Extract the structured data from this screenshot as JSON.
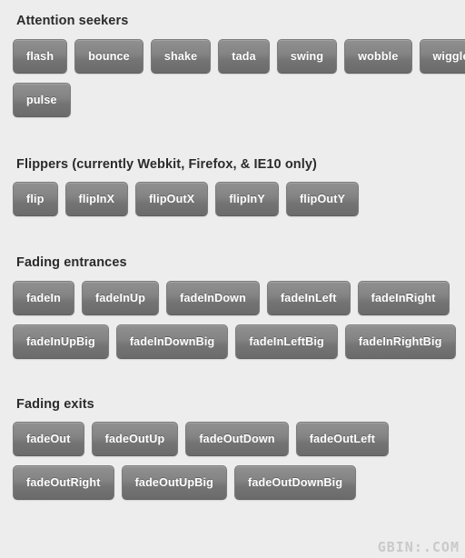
{
  "background_color": "#ededed",
  "button_colors": {
    "gradient_top": "#909090",
    "gradient_bottom": "#6b6b6b",
    "border": "#7b7b7b",
    "text": "#ffffff"
  },
  "heading_color": "#2b2b2b",
  "sections": [
    {
      "id": "attention",
      "title": "Attention seekers",
      "rows": [
        [
          "flash",
          "bounce",
          "shake",
          "tada",
          "swing",
          "wobble",
          "wiggle"
        ],
        [
          "pulse"
        ]
      ]
    },
    {
      "id": "flippers",
      "title": "Flippers (currently Webkit, Firefox, & IE10 only)",
      "rows": [
        [
          "flip",
          "flipInX",
          "flipOutX",
          "flipInY",
          "flipOutY"
        ]
      ]
    },
    {
      "id": "fadein",
      "title": "Fading entrances",
      "rows": [
        [
          "fadeIn",
          "fadeInUp",
          "fadeInDown",
          "fadeInLeft",
          "fadeInRight"
        ],
        [
          "fadeInUpBig",
          "fadeInDownBig",
          "fadeInLeftBig",
          "fadeInRightBig"
        ]
      ]
    },
    {
      "id": "fadeout",
      "title": "Fading exits",
      "rows": [
        [
          "fadeOut",
          "fadeOutUp",
          "fadeOutDown",
          "fadeOutLeft"
        ],
        [
          "fadeOutRight",
          "fadeOutUpBig",
          "fadeOutDownBig"
        ]
      ]
    }
  ],
  "watermark": {
    "text": "GBIN։.COM"
  }
}
